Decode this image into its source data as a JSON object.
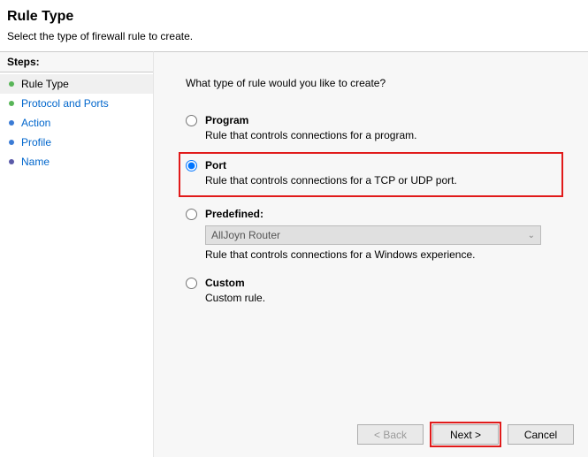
{
  "header": {
    "title": "Rule Type",
    "subtitle": "Select the type of firewall rule to create."
  },
  "sidebar": {
    "heading": "Steps:",
    "items": [
      {
        "label": "Rule Type"
      },
      {
        "label": "Protocol and Ports"
      },
      {
        "label": "Action"
      },
      {
        "label": "Profile"
      },
      {
        "label": "Name"
      }
    ]
  },
  "main": {
    "question": "What type of rule would you like to create?",
    "options": {
      "program": {
        "label": "Program",
        "desc": "Rule that controls connections for a program."
      },
      "port": {
        "label": "Port",
        "desc": "Rule that controls connections for a TCP or UDP port."
      },
      "predefined": {
        "label": "Predefined:",
        "selected": "AllJoyn Router",
        "desc": "Rule that controls connections for a Windows experience."
      },
      "custom": {
        "label": "Custom",
        "desc": "Custom rule."
      }
    }
  },
  "buttons": {
    "back": "< Back",
    "next": "Next >",
    "cancel": "Cancel"
  }
}
